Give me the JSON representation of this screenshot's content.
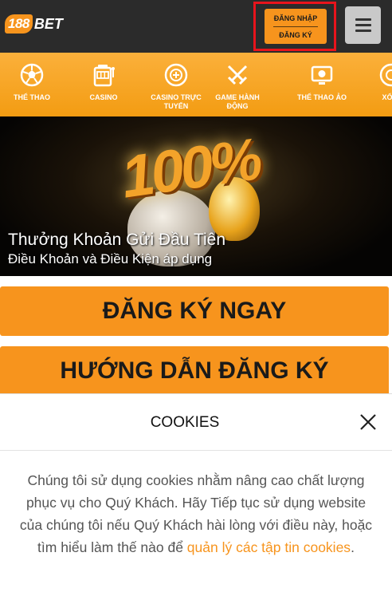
{
  "header": {
    "logo_number": "188",
    "logo_text": "BET",
    "login_label": "ĐĂNG NHẬP",
    "register_label": "ĐĂNG KÝ",
    "menu_icon": "hamburger-icon"
  },
  "nav": {
    "items": [
      {
        "label": "THỂ THAO",
        "icon": "soccer-ball-icon"
      },
      {
        "label": "CASINO",
        "icon": "slot-machine-icon"
      },
      {
        "label": "CASINO TRỰC TUYẾN",
        "icon": "roulette-chip-icon"
      },
      {
        "label": "GAME HÀNH ĐỘNG",
        "icon": "crossed-swords-icon"
      },
      {
        "label": "THỂ THAO ẢO",
        "icon": "virtual-sports-screen-icon"
      },
      {
        "label": "XỔ",
        "icon": "lottery-ball-icon"
      }
    ]
  },
  "banner": {
    "image_text": "100%",
    "title": "Thưởng Khoản Gửi Đầu Tiên",
    "subtitle": "Điều Khoản và Điều Kiện áp dụng"
  },
  "cta": {
    "register_now": "ĐĂNG KÝ NGAY",
    "register_guide": "HƯỚNG DẪN ĐĂNG KÝ"
  },
  "cookies": {
    "title": "COOKIES",
    "body": "Chúng tôi sử dụng cookies nhằm nâng cao chất lượng phục vụ cho Quý Khách. Hãy Tiếp tục sử dụng website của chúng tôi nếu Quý Khách hài lòng với điều này, hoặc tìm hiểu làm thế nào để ",
    "link": "quản lý các tập tin cookies",
    "end": "."
  },
  "colors": {
    "accent": "#f7941d",
    "header_bg": "#2b2b2b",
    "highlight_border": "#e8141c"
  }
}
